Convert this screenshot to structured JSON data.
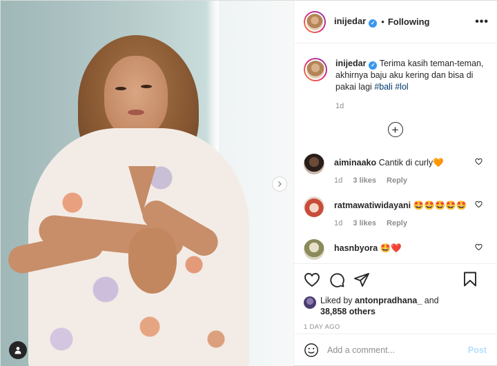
{
  "post": {
    "username": "inijedar",
    "verified_mark": "✓",
    "dot": "•",
    "follow_status": "Following",
    "more_label": "•••"
  },
  "caption": {
    "username": "inijedar",
    "text": "Terima kasih teman-teman, akhirnya baju aku kering dan bisa di pakai lagi",
    "hashtags": [
      "#bali",
      "#lol"
    ],
    "time": "1d"
  },
  "load_more_icon": "plus-circle-icon",
  "comments": [
    {
      "username": "aiminaako",
      "text": "Cantik di curly🧡",
      "time": "1d",
      "likes": "3 likes",
      "reply": "Reply"
    },
    {
      "username": "ratmawatiwidayani",
      "text": "🤩🤩🤩🤩🤩",
      "time": "1d",
      "likes": "3 likes",
      "reply": "Reply"
    },
    {
      "username": "hasnbyora",
      "text": "🤩❤️"
    }
  ],
  "likes": {
    "prefix": "Liked by",
    "user": "antonpradhana_",
    "and": "and",
    "others": "38,858 others"
  },
  "timestamp": "1 DAY AGO",
  "composer": {
    "placeholder": "Add a comment...",
    "post_label": "Post"
  },
  "colors": {
    "link": "#00376b",
    "verified": "#3897f0",
    "post_disabled": "#b2dffc",
    "muted": "#8e8e8e"
  }
}
